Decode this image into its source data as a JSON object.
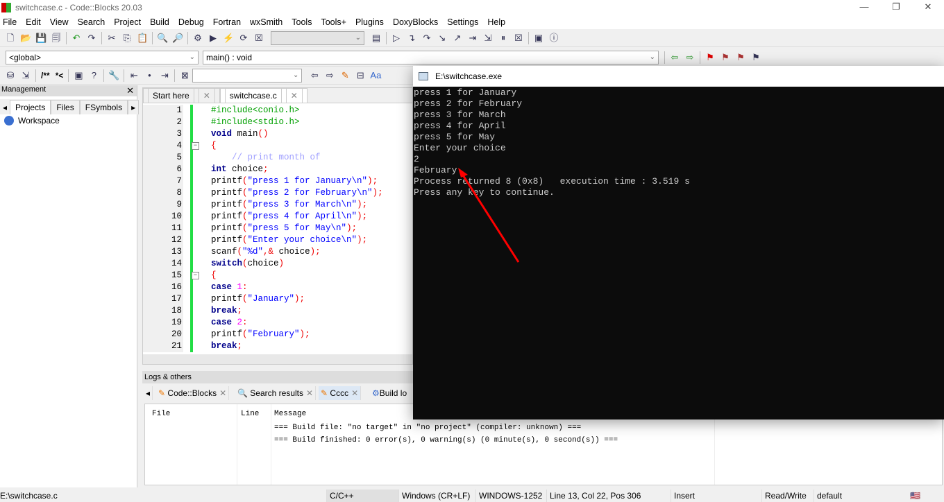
{
  "window": {
    "title": "switchcase.c - Code::Blocks 20.03",
    "min": "—",
    "max": "❐",
    "close": "✕"
  },
  "menu": [
    "File",
    "Edit",
    "View",
    "Search",
    "Project",
    "Build",
    "Debug",
    "Fortran",
    "wxSmith",
    "Tools",
    "Tools+",
    "Plugins",
    "DoxyBlocks",
    "Settings",
    "Help"
  ],
  "toolbar": {
    "scope": "<global>",
    "function": "main() : void",
    "doxy_comment": "/**",
    "doxy_inline": "*<"
  },
  "management": {
    "title": "Management",
    "tabs": [
      "Projects",
      "Files",
      "FSymbols"
    ],
    "workspace": "Workspace"
  },
  "editor": {
    "tabs": [
      "Start here",
      "switchcase.c"
    ],
    "active_tab": "switchcase.c",
    "lines": [
      [
        [
          "pp",
          "#include<conio.h>"
        ]
      ],
      [
        [
          "pp",
          "#include<stdio.h>"
        ]
      ],
      [
        [
          "kw",
          "void"
        ],
        [
          "tx",
          " main"
        ],
        [
          "op",
          "()"
        ]
      ],
      [
        [
          "op",
          "{"
        ]
      ],
      [
        [
          "cm",
          "    // print month of"
        ]
      ],
      [
        [
          "kw",
          "int"
        ],
        [
          "tx",
          " choice"
        ],
        [
          "op",
          ";"
        ]
      ],
      [
        [
          "tx",
          "printf"
        ],
        [
          "op",
          "("
        ],
        [
          "st",
          "\"press 1 for January\\n\""
        ],
        [
          "op",
          ");"
        ]
      ],
      [
        [
          "tx",
          "printf"
        ],
        [
          "op",
          "("
        ],
        [
          "st",
          "\"press 2 for February\\n\""
        ],
        [
          "op",
          ");"
        ]
      ],
      [
        [
          "tx",
          "printf"
        ],
        [
          "op",
          "("
        ],
        [
          "st",
          "\"press 3 for March\\n\""
        ],
        [
          "op",
          ");"
        ]
      ],
      [
        [
          "tx",
          "printf"
        ],
        [
          "op",
          "("
        ],
        [
          "st",
          "\"press 4 for April\\n\""
        ],
        [
          "op",
          ");"
        ]
      ],
      [
        [
          "tx",
          "printf"
        ],
        [
          "op",
          "("
        ],
        [
          "st",
          "\"press 5 for May\\n\""
        ],
        [
          "op",
          ");"
        ]
      ],
      [
        [
          "tx",
          "printf"
        ],
        [
          "op",
          "("
        ],
        [
          "st",
          "\"Enter your choice\\n\""
        ],
        [
          "op",
          ");"
        ]
      ],
      [
        [
          "tx",
          "scanf"
        ],
        [
          "op",
          "("
        ],
        [
          "st",
          "\"%d\""
        ],
        [
          "op",
          ",&"
        ],
        [
          "tx",
          " choice"
        ],
        [
          "op",
          ");"
        ]
      ],
      [
        [
          "kw",
          "switch"
        ],
        [
          "op",
          "("
        ],
        [
          "tx",
          "choice"
        ],
        [
          "op",
          ")"
        ]
      ],
      [
        [
          "op",
          "{"
        ]
      ],
      [
        [
          "kw",
          "case"
        ],
        [
          "tx",
          " "
        ],
        [
          "nm",
          "1"
        ],
        [
          "op",
          ":"
        ]
      ],
      [
        [
          "tx",
          "printf"
        ],
        [
          "op",
          "("
        ],
        [
          "st",
          "\"January\""
        ],
        [
          "op",
          ");"
        ]
      ],
      [
        [
          "kw",
          "break"
        ],
        [
          "op",
          ";"
        ]
      ],
      [
        [
          "kw",
          "case"
        ],
        [
          "tx",
          " "
        ],
        [
          "nm",
          "2"
        ],
        [
          "op",
          ":"
        ]
      ],
      [
        [
          "tx",
          "printf"
        ],
        [
          "op",
          "("
        ],
        [
          "st",
          "\"February\""
        ],
        [
          "op",
          ");"
        ]
      ],
      [
        [
          "kw",
          "break"
        ],
        [
          "op",
          ";"
        ]
      ]
    ]
  },
  "console": {
    "title": "E:\\switchcase.exe",
    "output": "press 1 for January\npress 2 for February\npress 3 for March\npress 4 for April\npress 5 for May\nEnter your choice\n2\nFebruary\nProcess returned 8 (0x8)   execution time : 3.519 s\nPress any key to continue."
  },
  "logs": {
    "title": "Logs & others",
    "tabs": [
      "Code::Blocks",
      "Search results",
      "Cccc",
      "Build lo"
    ],
    "columns": [
      "File",
      "Line",
      "Message"
    ],
    "messages": [
      "=== Build file: \"no target\" in \"no project\" (compiler: unknown) ===",
      "=== Build finished: 0 error(s), 0 warning(s) (0 minute(s), 0 second(s)) ==="
    ]
  },
  "status": {
    "file": "E:\\switchcase.c",
    "language": "C/C++",
    "eol": "Windows (CR+LF)",
    "encoding": "WINDOWS-1252",
    "position": "Line 13, Col 22, Pos 306",
    "mode": "Insert",
    "access": "Read/Write",
    "theme": "default"
  },
  "colors": {
    "arrow": "#ff0000",
    "console_bg": "#0c0c0c",
    "changebar": "#22dd44"
  }
}
